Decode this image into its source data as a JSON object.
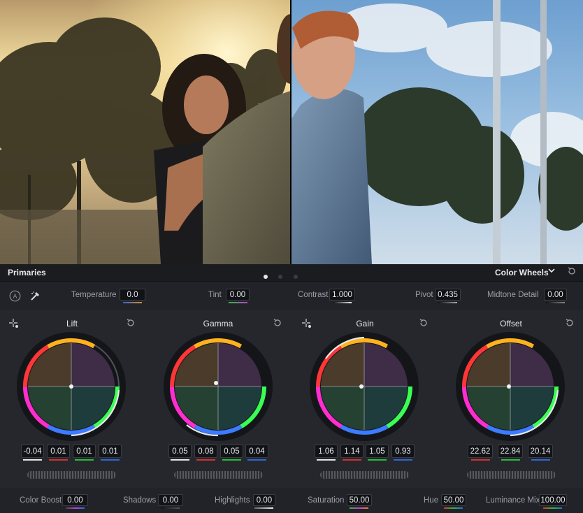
{
  "viewer": {
    "split": "before-after"
  },
  "panel": {
    "title": "Primaries",
    "page_indicator": {
      "current": 1,
      "total": 3
    },
    "mode_label": "Color Wheels",
    "mode_icon": "chevron-down-icon",
    "reset_icon": "reset-icon"
  },
  "params_top": {
    "temperature": {
      "label": "Temperature",
      "value": "0.0"
    },
    "tint": {
      "label": "Tint",
      "value": "0.00"
    },
    "contrast": {
      "label": "Contrast",
      "value": "1.000"
    },
    "pivot": {
      "label": "Pivot",
      "value": "0.435"
    },
    "midtone_detail": {
      "label": "Midtone Detail",
      "value": "0.00"
    }
  },
  "wheels": [
    {
      "label": "Lift",
      "values": [
        "-0.04",
        "0.01",
        "0.01",
        "0.01"
      ]
    },
    {
      "label": "Gamma",
      "values": [
        "0.05",
        "0.08",
        "0.05",
        "0.04"
      ]
    },
    {
      "label": "Gain",
      "values": [
        "1.06",
        "1.14",
        "1.05",
        "0.93"
      ]
    },
    {
      "label": "Offset",
      "values": [
        "22.62",
        "22.84",
        "20.14"
      ]
    }
  ],
  "params_bottom": {
    "color_boost": {
      "label": "Color Boost",
      "value": "0.00"
    },
    "shadows": {
      "label": "Shadows",
      "value": "0.00"
    },
    "highlights": {
      "label": "Highlights",
      "value": "0.00"
    },
    "saturation": {
      "label": "Saturation",
      "value": "50.00"
    },
    "hue": {
      "label": "Hue",
      "value": "50.00"
    },
    "luminance_mix": {
      "label": "Luminance Mix",
      "value": "100.00"
    }
  },
  "colors": {
    "white": "#e8e8e8",
    "red": "#d8312f",
    "green": "#2bbd3c",
    "blue": "#2e68d8",
    "orange": "#e08a23"
  }
}
